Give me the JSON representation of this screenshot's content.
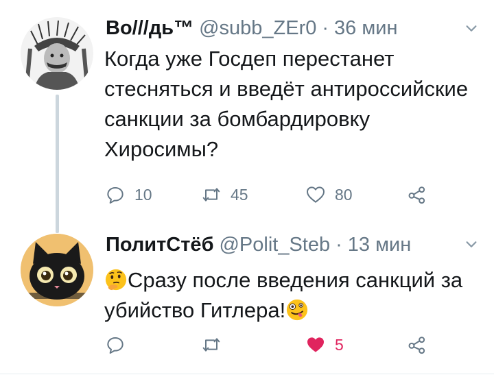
{
  "tweets": [
    {
      "name": "Во///дь™",
      "handle": "@subb_ZEr0",
      "separator": "·",
      "time": "36 мин",
      "text": "Когда уже Госдеп перестанет стесняться и введёт антироссийские санкции за бомбардировку Хиросимы?",
      "replies": "10",
      "retweets": "45",
      "likes": "80",
      "avatar_icon": "portrait-avatar"
    },
    {
      "name": "ПолитСтёб",
      "handle": "@Polit_Steb",
      "separator": "·",
      "time": "13 мин",
      "text": "Сразу после введения санкций за убийство Гитлера!",
      "replies": "",
      "retweets": "",
      "likes": "5",
      "liked": true,
      "avatar_icon": "cat-avatar",
      "leading_emoji": "thinking-face-emoji",
      "trailing_emoji": "zany-face-emoji"
    }
  ],
  "colors": {
    "text": "#14171a",
    "muted": "#657786",
    "like_active": "#e0245e",
    "thread_line": "#ccd6dd"
  }
}
